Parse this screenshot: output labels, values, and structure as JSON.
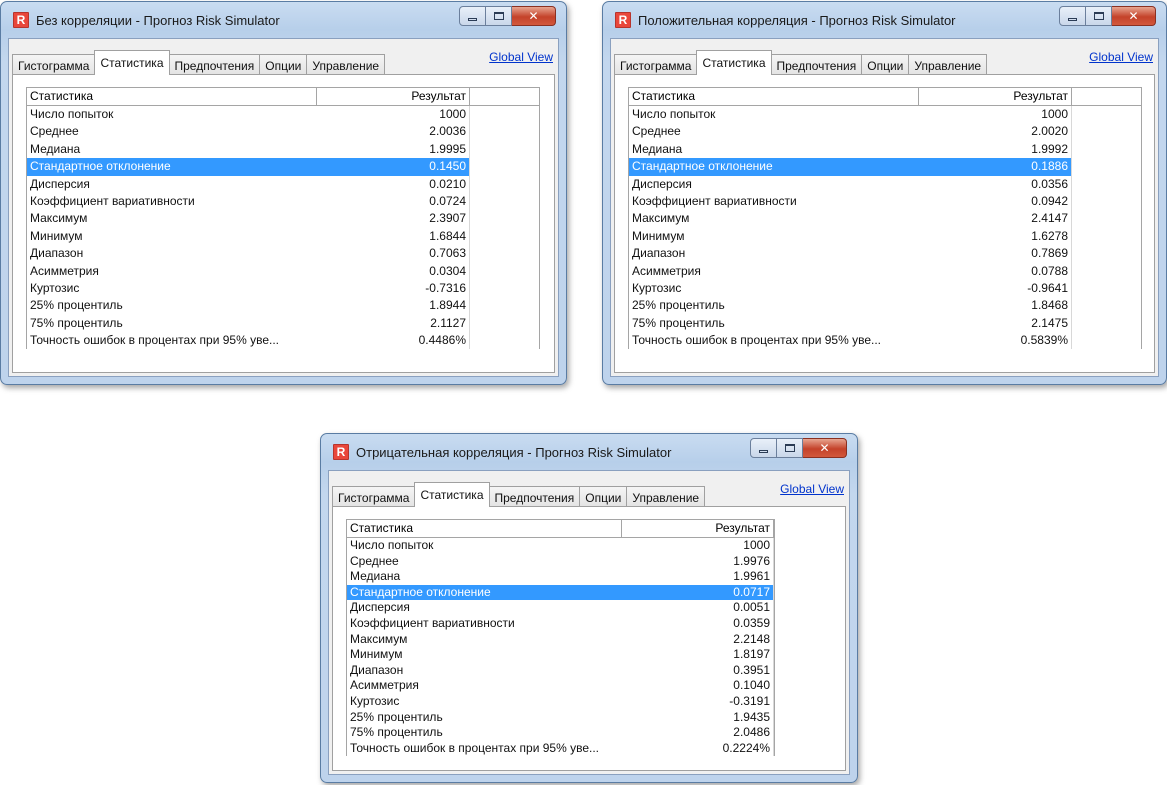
{
  "windows": [
    {
      "title": "Без корреляции - Прогноз Risk Simulator",
      "tabs": [
        "Гистограмма",
        "Статистика",
        "Предпочтения",
        "Опции",
        "Управление"
      ],
      "active_tab": "Статистика",
      "global_view": "Global View",
      "header": {
        "stat": "Статистика",
        "result": "Результат"
      },
      "selected_row": "Стандартное отклонение",
      "rows": [
        {
          "label": "Число попыток",
          "value": "1000"
        },
        {
          "label": "Среднее",
          "value": "2.0036"
        },
        {
          "label": "Медиана",
          "value": "1.9995"
        },
        {
          "label": "Стандартное отклонение",
          "value": "0.1450"
        },
        {
          "label": "Дисперсия",
          "value": "0.0210"
        },
        {
          "label": "Коэффициент вариативности",
          "value": "0.0724"
        },
        {
          "label": "Максимум",
          "value": "2.3907"
        },
        {
          "label": "Минимум",
          "value": "1.6844"
        },
        {
          "label": "Диапазон",
          "value": "0.7063"
        },
        {
          "label": "Асимметрия",
          "value": "0.0304"
        },
        {
          "label": "Куртозис",
          "value": "-0.7316"
        },
        {
          "label": "25% процентиль",
          "value": "1.8944"
        },
        {
          "label": "75% процентиль",
          "value": "2.1127"
        },
        {
          "label": "Точность ошибок в процентах при 95% уве...",
          "value": "0.4486%"
        }
      ]
    },
    {
      "title": "Положительная корреляция - Прогноз Risk Simulator",
      "tabs": [
        "Гистограмма",
        "Статистика",
        "Предпочтения",
        "Опции",
        "Управление"
      ],
      "active_tab": "Статистика",
      "global_view": "Global View",
      "header": {
        "stat": "Статистика",
        "result": "Результат"
      },
      "selected_row": "Стандартное отклонение",
      "rows": [
        {
          "label": "Число попыток",
          "value": "1000"
        },
        {
          "label": "Среднее",
          "value": "2.0020"
        },
        {
          "label": "Медиана",
          "value": "1.9992"
        },
        {
          "label": "Стандартное отклонение",
          "value": "0.1886"
        },
        {
          "label": "Дисперсия",
          "value": "0.0356"
        },
        {
          "label": "Коэффициент вариативности",
          "value": "0.0942"
        },
        {
          "label": "Максимум",
          "value": "2.4147"
        },
        {
          "label": "Минимум",
          "value": "1.6278"
        },
        {
          "label": "Диапазон",
          "value": "0.7869"
        },
        {
          "label": "Асимметрия",
          "value": "0.0788"
        },
        {
          "label": "Куртозис",
          "value": "-0.9641"
        },
        {
          "label": "25% процентиль",
          "value": "1.8468"
        },
        {
          "label": "75% процентиль",
          "value": "2.1475"
        },
        {
          "label": "Точность ошибок в процентах при 95% уве...",
          "value": "0.5839%"
        }
      ]
    },
    {
      "title": "Отрицательная корреляция - Прогноз Risk Simulator",
      "tabs": [
        "Гистограмма",
        "Статистика",
        "Предпочтения",
        "Опции",
        "Управление"
      ],
      "active_tab": "Статистика",
      "global_view": "Global View",
      "header": {
        "stat": "Статистика",
        "result": "Результат"
      },
      "selected_row": "Стандартное отклонение",
      "rows": [
        {
          "label": "Число попыток",
          "value": "1000"
        },
        {
          "label": "Среднее",
          "value": "1.9976"
        },
        {
          "label": "Медиана",
          "value": "1.9961"
        },
        {
          "label": "Стандартное отклонение",
          "value": "0.0717"
        },
        {
          "label": "Дисперсия",
          "value": "0.0051"
        },
        {
          "label": "Коэффициент вариативности",
          "value": "0.0359"
        },
        {
          "label": "Максимум",
          "value": "2.2148"
        },
        {
          "label": "Минимум",
          "value": "1.8197"
        },
        {
          "label": "Диапазон",
          "value": "0.3951"
        },
        {
          "label": "Асимметрия",
          "value": "0.1040"
        },
        {
          "label": "Куртозис",
          "value": "-0.3191"
        },
        {
          "label": "25% процентиль",
          "value": "1.9435"
        },
        {
          "label": "75% процентиль",
          "value": "2.0486"
        },
        {
          "label": "Точность ошибок в процентах при 95% уве...",
          "value": "0.2224%"
        }
      ]
    }
  ],
  "colors": {
    "selection": "#3399ff",
    "close_button": "#c4422a",
    "link": "#0033cc",
    "frame": "#c9dcf1"
  },
  "icons": {
    "app": "risk-simulator-logo",
    "minimize": "minimize-icon",
    "maximize": "maximize-icon",
    "close": "close-icon"
  }
}
